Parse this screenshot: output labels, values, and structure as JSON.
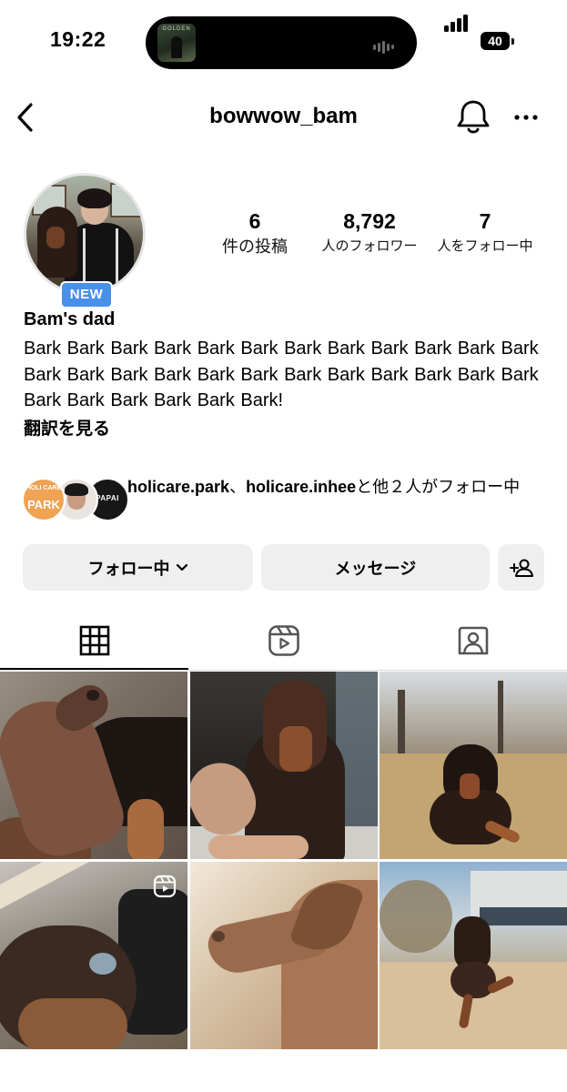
{
  "status_bar": {
    "time": "19:22",
    "now_playing_art_text": "GOLDEN",
    "battery": "40"
  },
  "header": {
    "username": "bowwow_bam"
  },
  "profile": {
    "new_badge": "NEW",
    "stats": {
      "posts": {
        "value": "6",
        "label": "件の投稿"
      },
      "followers": {
        "value": "8,792",
        "label": "人のフォロワー"
      },
      "following": {
        "value": "7",
        "label": "人をフォロー中"
      }
    },
    "display_name": "Bam's dad",
    "bio": "Bark Bark Bark Bark Bark Bark Bark Bark Bark Bark Bark Bark Bark Bark Bark Bark Bark Bark Bark Bark Bark Bark Bark Bark Bark Bark Bark Bark Bark Bark!",
    "translate_label": "翻訳を見る"
  },
  "mutual": {
    "avatar_labels": {
      "first_top": "HOLI CARE",
      "first_bottom": "PARK",
      "third": "PAPAI"
    },
    "user1": "holicare.park",
    "separator": "、",
    "user2": "holicare.inhee",
    "rest": "と他２人がフォロー中"
  },
  "actions": {
    "follow_label": "フォロー中",
    "message_label": "メッセージ"
  },
  "tabs": {
    "active": "grid",
    "items": [
      "grid",
      "reels",
      "tagged"
    ]
  },
  "posts": [
    {
      "subject": "doberman profile looking up"
    },
    {
      "subject": "doberman being washed"
    },
    {
      "subject": "doberman lying on grass"
    },
    {
      "subject": "doberman close-up",
      "is_reel": true
    },
    {
      "subject": "doberman side profile"
    },
    {
      "subject": "doberman running"
    }
  ],
  "icons": {
    "back": "chevron-left-icon",
    "bell": "bell-icon",
    "more": "more-horizontal-icon",
    "chevron": "chevron-down-icon",
    "add_user": "add-user-icon",
    "grid": "grid-icon",
    "reels": "reels-icon",
    "tagged": "tagged-icon"
  },
  "colors": {
    "badge": "#4a90e8",
    "button_bg": "#efefef",
    "divider": "#dbdbdb"
  }
}
